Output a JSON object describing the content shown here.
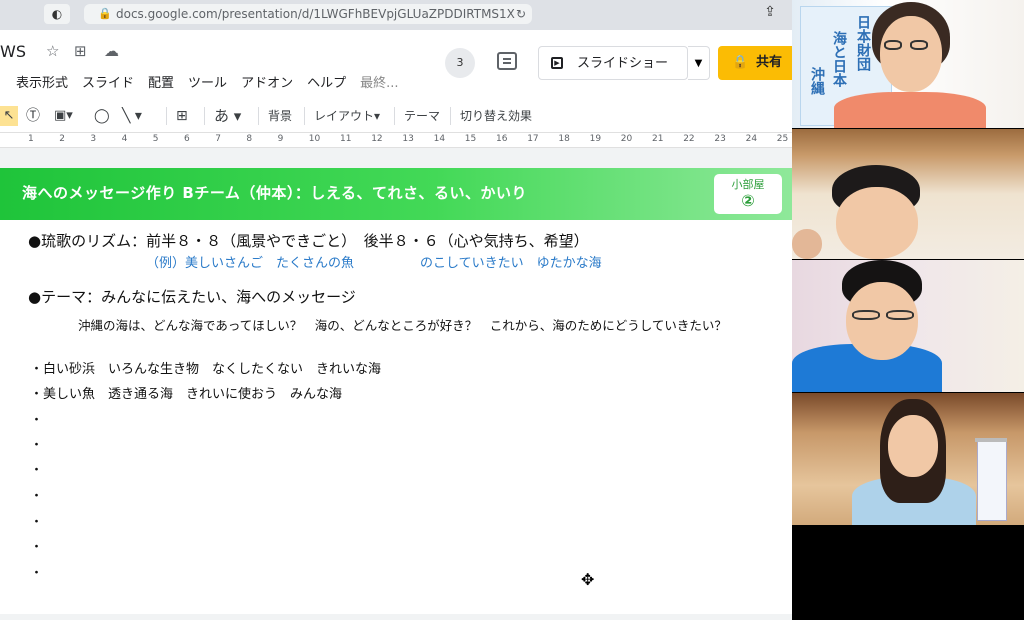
{
  "browser": {
    "url": "docs.google.com/presentation/d/1LWGFhBEVpjGLUaZPDDIRTMS1X"
  },
  "header": {
    "doc_title": "WS",
    "menu": [
      "表示形式",
      "スライド",
      "配置",
      "ツール",
      "アドオン",
      "ヘルプ",
      "最終..."
    ],
    "viewer_count": "3",
    "slideshow_label": "スライドショー",
    "share_label": "共有"
  },
  "toolbar": {
    "text_style": "あ",
    "background": "背景",
    "layout": "レイアウト",
    "theme": "テーマ",
    "transition": "切り替え効果"
  },
  "ruler": {
    "ticks": [
      "1",
      "2",
      "3",
      "4",
      "5",
      "6",
      "7",
      "8",
      "9",
      "10",
      "11",
      "12",
      "13",
      "14",
      "15",
      "16",
      "17",
      "18",
      "19",
      "20",
      "21",
      "22",
      "23",
      "24",
      "25"
    ]
  },
  "slide": {
    "banner_title": "海へのメッセージ作り Bチーム（仲本）：しえる、てれさ、るい、かいり",
    "room_label": "小部屋",
    "room_number": "②",
    "rhythm_heading": "●琉歌のリズム：前半８・８（風景やできごと）　後半８・６（心や気持ち、希望）",
    "rhythm_example_1": "（例）美しいさんご　たくさんの魚",
    "rhythm_example_2": "のこしていきたい　ゆたかな海",
    "theme_heading": "●テーマ：みんなに伝えたい、海へのメッセージ",
    "theme_questions": "沖縄の海は、どんな海であってほしい？　海の、どんなところが好き？　これから、海のためにどうしていきたい？",
    "bullets": [
      "・白い砂浜　いろんな生き物　なくしたくない　きれいな海",
      "・美しい魚　透き通る海　きれいに使おう　みんな海",
      "・",
      "・",
      "・",
      "・",
      "・",
      "・",
      "・"
    ]
  },
  "video": {
    "sign_text_1": "日本財団",
    "sign_text_2": "海と日本",
    "sign_text_3": "沖縄"
  }
}
